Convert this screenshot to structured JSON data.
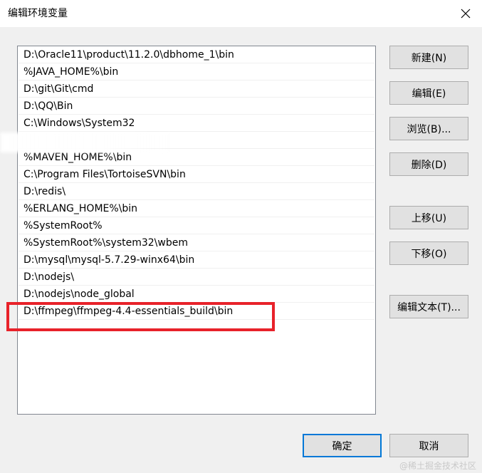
{
  "dialog": {
    "title": "编辑环境变量",
    "close_icon": "close-icon"
  },
  "path_list": {
    "items": [
      "D:\\Oracle11\\product\\11.2.0\\dbhome_1\\bin",
      "%JAVA_HOME%\\bin",
      "D:\\git\\Git\\cmd",
      "D:\\QQ\\Bin",
      "C:\\Windows\\System32",
      "",
      "%MAVEN_HOME%\\bin",
      "C:\\Program Files\\TortoiseSVN\\bin",
      "D:\\redis\\",
      "%ERLANG_HOME%\\bin",
      "%SystemRoot%",
      "%SystemRoot%\\system32\\wbem",
      "D:\\mysql\\mysql-5.7.29-winx64\\bin",
      "D:\\nodejs\\",
      "D:\\nodejs\\node_global",
      "D:\\ffmpeg\\ffmpeg-4.4-essentials_build\\bin"
    ]
  },
  "buttons": {
    "new": "新建(N)",
    "edit": "编辑(E)",
    "browse": "浏览(B)...",
    "delete": "删除(D)",
    "move_up": "上移(U)",
    "move_down": "下移(O)",
    "edit_text": "编辑文本(T)...",
    "ok": "确定",
    "cancel": "取消"
  },
  "annotation": {
    "highlight_color": "#e8222a"
  },
  "watermark": "@稀土掘金技术社区"
}
